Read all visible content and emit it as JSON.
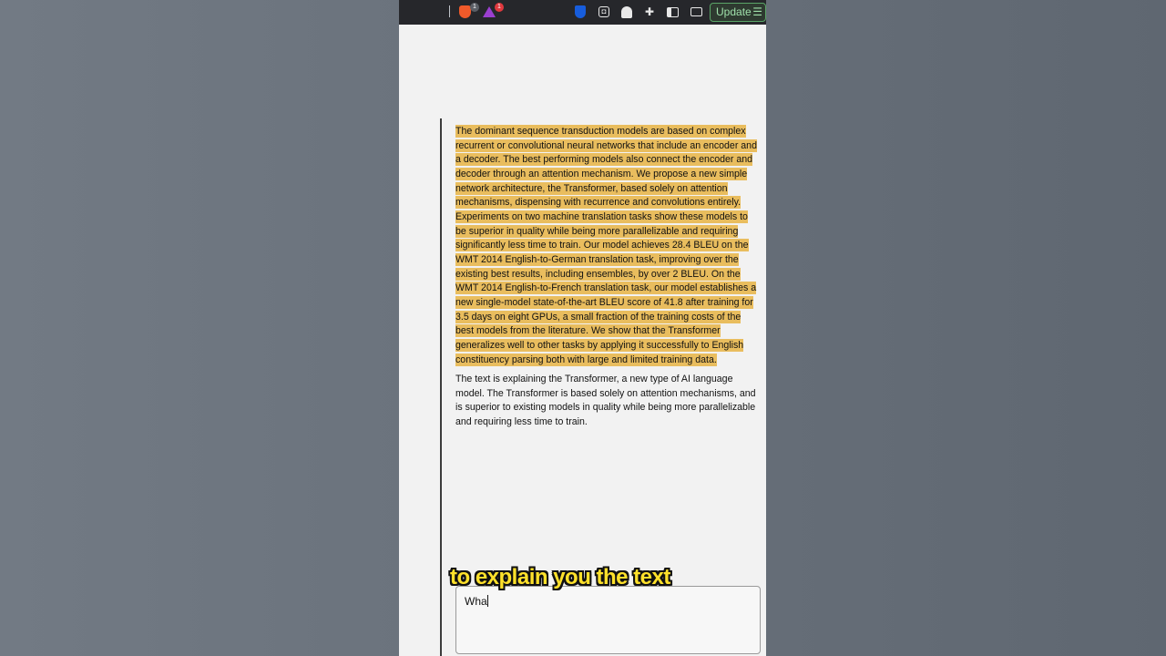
{
  "toolbar": {
    "brave_badge": "1",
    "rewards_badge": "1",
    "update_label": "Update",
    "icons": [
      "brave-shield-icon",
      "brave-rewards-icon",
      "bitwarden-icon",
      "mask-icon",
      "ghost-icon",
      "puzzle-icon",
      "sidebar-icon",
      "wallet-icon",
      "menu-icon"
    ]
  },
  "document": {
    "highlighted_text": " The dominant sequence transduction models are based on complex recurrent or convolutional neural networks that include an encoder and a decoder. The best performing models also connect the encoder and decoder through an attention mechanism. We propose a new simple network architecture, the Transformer, based solely on attention mechanisms, dispensing with recurrence and convolutions entirely. Experiments on two machine translation tasks show these models to be superior in quality while being more parallelizable and requiring significantly less time to train. Our model achieves 28.4 BLEU on the WMT 2014 English-to-German translation task, improving over the existing best results, including ensembles, by over 2 BLEU. On the WMT 2014 English-to-French translation task, our model establishes a new single-model state-of-the-art BLEU score of 41.8 after training for 3.5 days on eight GPUs, a small fraction of the training costs of the best models from the literature. We show that the Transformer generalizes well to other tasks by applying it successfully to English constituency parsing both with large and limited training data. ",
    "explanation_text": "The text is explaining the Transformer, a new type of AI language model. The Transformer is based solely on attention mechanisms, and is superior to existing models in quality while being more parallelizable and requiring less time to train."
  },
  "input": {
    "value": "Wha"
  },
  "caption": {
    "text": "to explain you the text"
  },
  "colors": {
    "highlight": "#e9bd5e",
    "caption": "#ffe12b",
    "toolbar_bg": "#26272b"
  }
}
